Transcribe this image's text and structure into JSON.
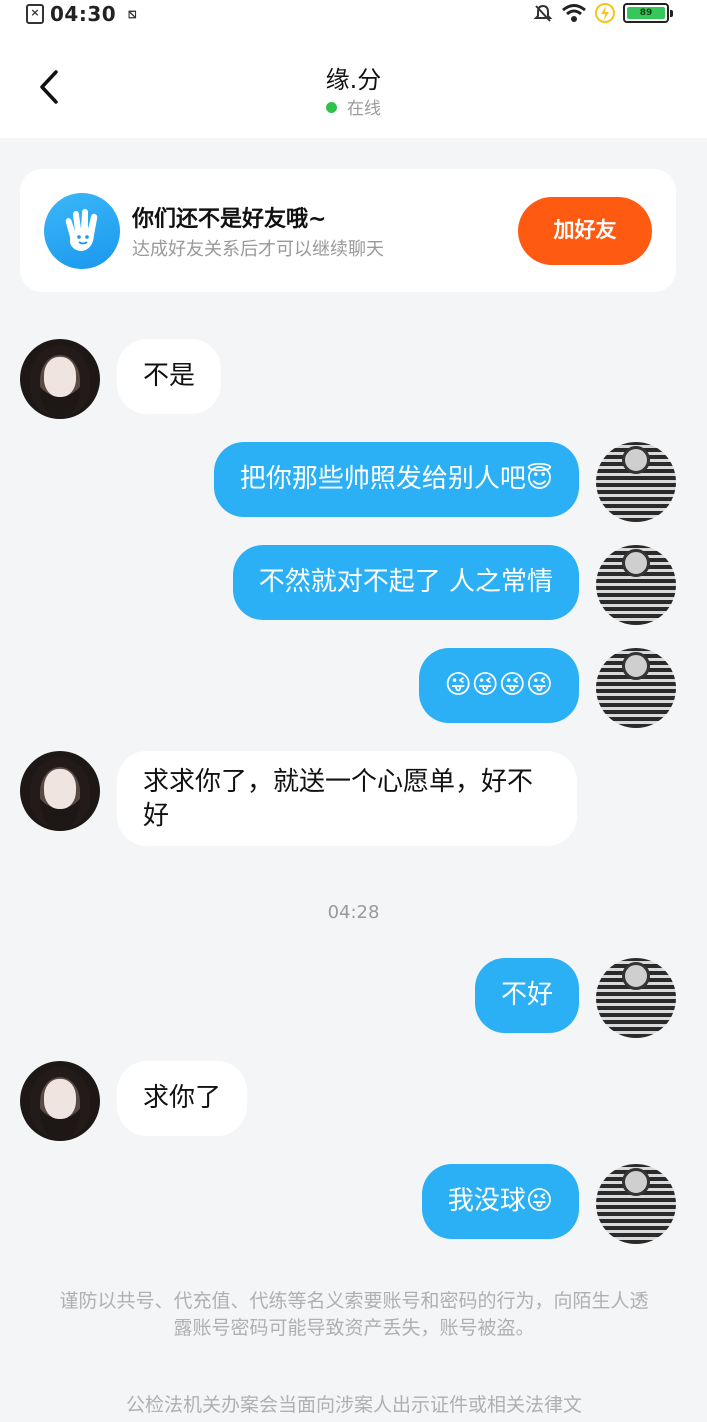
{
  "status_bar": {
    "time": "04:30",
    "battery": "89"
  },
  "header": {
    "title": "缘.分",
    "presence": "在线"
  },
  "friend_card": {
    "title": "你们还不是好友哦~",
    "subtitle": "达成好友关系后才可以继续聊天",
    "add_button": "加好友"
  },
  "messages": [
    {
      "from": "other",
      "text": "不是"
    },
    {
      "from": "self",
      "text": "把你那些帅照发给别人吧😇"
    },
    {
      "from": "self",
      "text": "不然就对不起了 人之常情"
    },
    {
      "from": "self",
      "text": "😜😜😜😜"
    },
    {
      "from": "other",
      "text": "求求你了，就送一个心愿单，好不好"
    },
    {
      "from": "self",
      "text": "不好"
    },
    {
      "from": "other",
      "text": "求你了"
    },
    {
      "from": "self",
      "text": "我没球😜"
    }
  ],
  "time_separator": "04:28",
  "notices": [
    "谨防以共号、代充值、代练等名义索要账号和密码的行为，向陌生人透露账号密码可能导致资产丢失，账号被盗。",
    "公检法机关办案会当面向涉案人出示证件或相关法律文"
  ]
}
